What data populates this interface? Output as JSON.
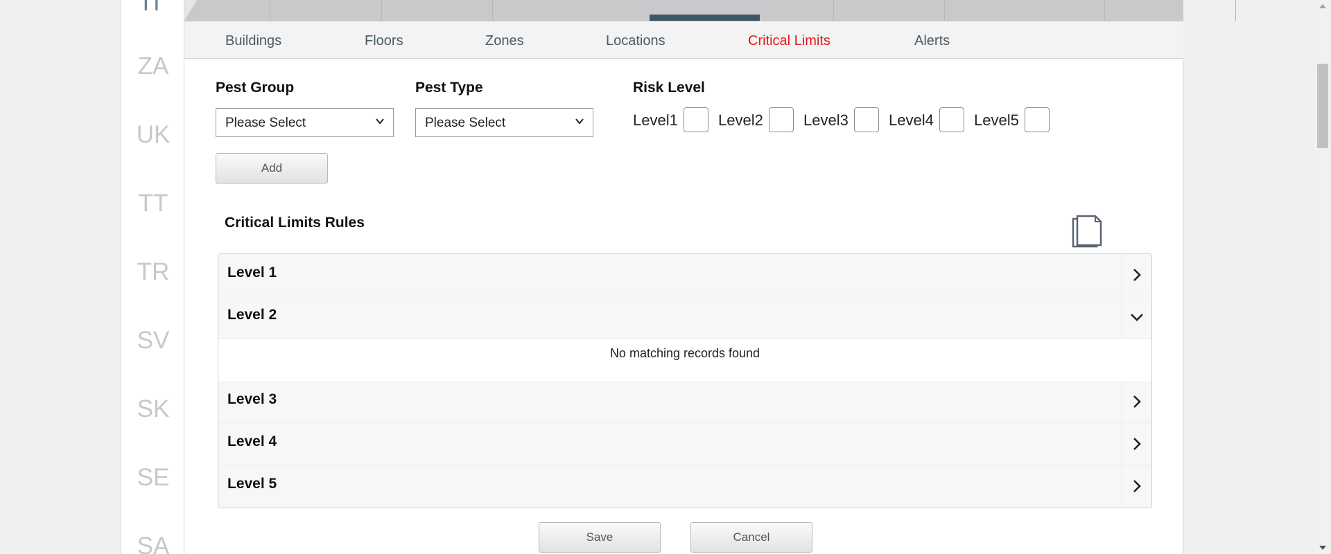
{
  "countries": [
    {
      "code": "IT",
      "active": true
    },
    {
      "code": "ZA"
    },
    {
      "code": "UK"
    },
    {
      "code": "TT"
    },
    {
      "code": "TR"
    },
    {
      "code": "SV"
    },
    {
      "code": "SK"
    },
    {
      "code": "SE"
    },
    {
      "code": "SA"
    }
  ],
  "subnav": {
    "tabs": [
      "Buildings",
      "Floors",
      "Zones",
      "Locations",
      "Critical Limits",
      "Alerts"
    ],
    "active": "Critical Limits"
  },
  "form": {
    "pest_group_label": "Pest Group",
    "pest_group_value": "Please Select",
    "pest_type_label": "Pest Type",
    "pest_type_value": "Please Select",
    "risk_level_label": "Risk Level",
    "levels": [
      "Level1",
      "Level2",
      "Level3",
      "Level4",
      "Level5"
    ],
    "add_label": "Add"
  },
  "rules": {
    "title": "Critical Limits Rules",
    "export_icon": "copy-document-icon",
    "levels": [
      {
        "label": "Level 1",
        "expanded": false
      },
      {
        "label": "Level 2",
        "expanded": true
      },
      {
        "label": "Level 3",
        "expanded": false
      },
      {
        "label": "Level 4",
        "expanded": false
      },
      {
        "label": "Level 5",
        "expanded": false
      }
    ],
    "empty_message": "No matching records found"
  },
  "footer": {
    "save_label": "Save",
    "cancel_label": "Cancel"
  },
  "colors": {
    "active_tab": "#e8161c",
    "nav_text": "#4a5a66",
    "active_country": "#6a8494",
    "active_top_indicator": "#3d5766"
  }
}
